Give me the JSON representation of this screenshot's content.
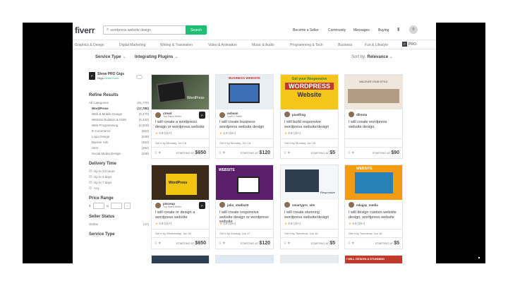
{
  "header": {
    "logo": "fiverr",
    "search_value": "wordpress website design",
    "search_button": "Search",
    "nav": [
      "Become a Seller",
      "Community",
      "Messages",
      "Buying"
    ]
  },
  "avatar_initial": "B",
  "categories": [
    "Graphics & Design",
    "Digital Marketing",
    "Writing & Translation",
    "Video & Animation",
    "Music & Audio",
    "Programming & Tech",
    "Business",
    "Fun & Lifestyle"
  ],
  "pro_label": "PRO",
  "filters": {
    "service_type": "Service Type",
    "integrating": "Integrating Plugins",
    "sort_label": "Sort by:",
    "sort_value": "Relevance"
  },
  "sidebar": {
    "promo_title": "Show PRO Gigs",
    "promo_sub": "Gigs",
    "promo_link": "Learn more",
    "refine_title": "Refine Results",
    "refine_items": [
      {
        "label": "All Categories",
        "count": "(51,779)",
        "sel": false
      },
      {
        "label": "WordPress",
        "count": "(17,780)",
        "sel": true
      },
      {
        "label": "Web & Mobile Design",
        "count": "(9,470)",
        "sel": false
      },
      {
        "label": "Website Builders & CMS",
        "count": "(5,434)",
        "sel": false
      },
      {
        "label": "Web Programming",
        "count": "(2,819)",
        "sel": false
      },
      {
        "label": "E-Commerce",
        "count": "(663)",
        "sel": false
      },
      {
        "label": "Logo Design",
        "count": "(539)",
        "sel": false
      },
      {
        "label": "Banner Ads",
        "count": "(463)",
        "sel": false
      },
      {
        "label": "SEO",
        "count": "(294)",
        "sel": false
      },
      {
        "label": "Social Media Design",
        "count": "(248)",
        "sel": false
      }
    ],
    "delivery_title": "Delivery Time",
    "delivery_options": [
      "Up to 24 hours",
      "Up to 3 days",
      "Up to 7 days",
      "Any"
    ],
    "price_title": "Price Range",
    "price_currency": "$",
    "price_to": "to",
    "seller_title": "Seller Status",
    "seller_option": "Online",
    "seller_count": "(47)",
    "service_title": "Service Type"
  },
  "gigs": [
    {
      "seller": "ctreat",
      "level": "Top Rated Seller",
      "title": "I will create a wordpress design or wordpress website",
      "rating": "4.9",
      "reviews": "(1k+)",
      "delivery": "Get it by Monday, Jun 18",
      "price": "$650"
    },
    {
      "seller": "ashsan",
      "level": "Level 2 Seller",
      "title": "I will create business wordpress website design",
      "rating": "4.9",
      "reviews": "(1k+)",
      "delivery": "Get it by Monday, Jun 18",
      "price": "$120"
    },
    {
      "seller": "pixelfrog",
      "level": "",
      "title": "I will build responsive wordpress website/design",
      "rating": "4.9",
      "reviews": "(1k+)",
      "delivery": "Get it by Monday, Jun 18",
      "price": "$5"
    },
    {
      "seller": "dfrenta",
      "level": "",
      "title": "I will create wordpress website design",
      "rating": "",
      "reviews": "",
      "delivery": "",
      "price": "$90"
    },
    {
      "seller": "pieceup",
      "level": "Top Rated Seller",
      "title": "I will create or design a wordpress website",
      "rating": "4.9",
      "reviews": "(1k+)",
      "delivery": "Get it by Wednesday, Jun 20",
      "price": "$650"
    },
    {
      "seller": "julio_studio23",
      "level": "",
      "title": "I will create responsive website design or wordpress website",
      "rating": "4.9",
      "reviews": "(1k+)",
      "delivery": "Get it by Sunday, Jun 17",
      "price": "$120"
    },
    {
      "seller": "smartypro_site",
      "level": "",
      "title": "I will create stunning wordpress website/design",
      "rating": "4.9",
      "reviews": "(1k+)",
      "delivery": "Get it by Tomorrow, Jun 16",
      "price": "$5"
    },
    {
      "seller": "mkajay_media",
      "level": "",
      "title": "I will design custom website design, wordpress website",
      "rating": "4.9",
      "reviews": "(1k+)",
      "delivery": "Get it by Tomorrow, Jun 16",
      "price": "$5"
    }
  ],
  "images": {
    "g1": "WordPress",
    "g2": "BUSINESS WEBSITE",
    "g3a": "Get your Responsive",
    "g3b": "WORDPRESS",
    "g3c": "Website",
    "g4": "UNCOVER YOUR STYLE",
    "g5": "WordPress",
    "g6": "WEBSITE",
    "g7": "Responsive",
    "g8": "WEBSITE",
    "g9": "I WILL DESIGN A STUNNING"
  },
  "starting_at": "STARTING AT",
  "colors": {
    "brand_green": "#1dbf73",
    "text_dark": "#404145",
    "text_muted": "#74767e",
    "star": "#ffb33e"
  }
}
